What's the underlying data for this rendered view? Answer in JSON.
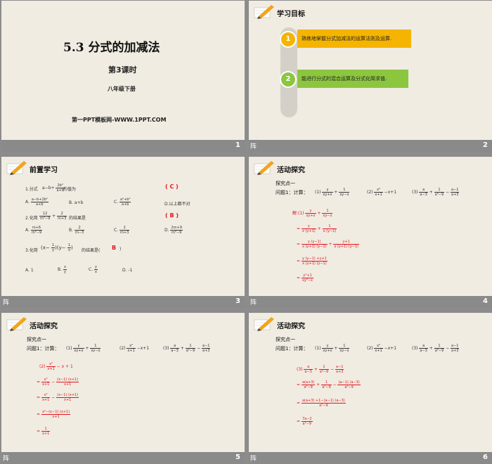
{
  "slides": [
    {
      "number": "2",
      "header": "学习目标",
      "goals": [
        {
          "num": "1",
          "text": "熟练地掌握分式加减法的运算法则及运算.",
          "color": "#f5b400"
        },
        {
          "num": "2",
          "text": "能进行分式的混合运算及分式化简求值.",
          "color": "#8cc63f"
        }
      ]
    },
    {
      "number": "3",
      "header": "前置学习",
      "q1_label": "1.分式",
      "q1_tail": "的值为",
      "q1_answer": "( C )",
      "q1_opts": [
        "A.",
        "B. a+b",
        "C.",
        "D.以上都不对"
      ],
      "q2_label": "2.化简",
      "q2_tail": "的结果是",
      "q2_answer": "( B )",
      "q2_opts": [
        "A.",
        "B.",
        "C.",
        "D."
      ],
      "q3_label": "3.化简",
      "q3_tail": "的结果是(",
      "q3_answer": "B",
      "q3_close": ")",
      "q3_opts": [
        "A. 1",
        "B.",
        "C.",
        "D. -1"
      ]
    },
    {
      "number": "4",
      "header": "活动探究",
      "point": "探究点一",
      "question": "问题1：计算：",
      "parts": [
        "(1)",
        "(2)",
        "(3)"
      ],
      "solution_label": "解:(1)"
    },
    {
      "number": "5",
      "header": "活动探究",
      "point": "探究点一",
      "question": "问题1：计算：",
      "parts": [
        "(1)",
        "(2)",
        "(3)"
      ],
      "solution_label": "(2)"
    },
    {
      "number": "6",
      "header": "活动探究",
      "point": "探究点一",
      "question": "问题1：计算：",
      "parts": [
        "(1)",
        "(2)",
        "(3)"
      ],
      "solution_label": "(3)"
    }
  ],
  "title_slide": {
    "number": "1",
    "title": "5.3  分式的加减法",
    "subtitle": "第3课时",
    "grade": "八年级下册",
    "brand": "第一PPT模板网-WWW.1PPT.COM"
  },
  "bar_glyph": "阵"
}
